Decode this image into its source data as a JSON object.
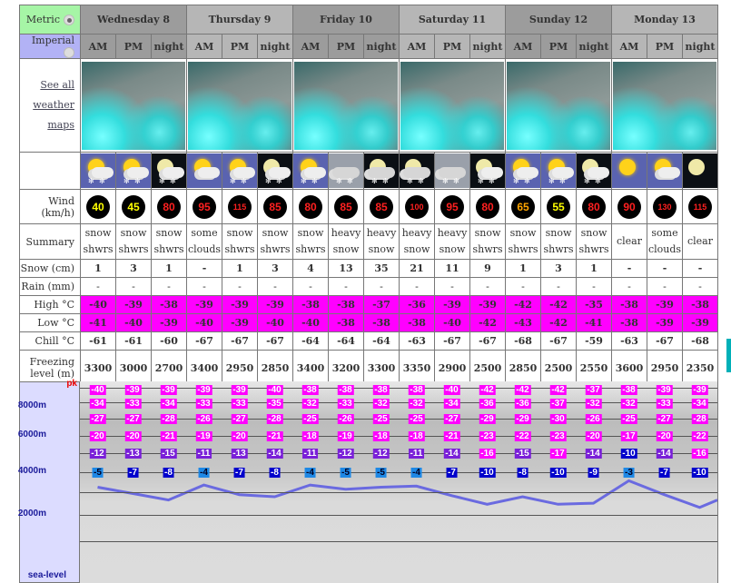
{
  "units": {
    "metric": "Metric",
    "imperial": "Imperial",
    "selected": "metric"
  },
  "days": [
    "Wednesday 8",
    "Thursday 9",
    "Friday 10",
    "Saturday 11",
    "Sunday 12",
    "Monday 13"
  ],
  "periods": [
    "AM",
    "PM",
    "night"
  ],
  "maps_link": [
    "See all",
    "weather",
    "maps"
  ],
  "labels": {
    "wind": [
      "Wind",
      "(km/h)"
    ],
    "summary": "Summary",
    "snow": "Snow (cm)",
    "rain": "Rain (mm)",
    "high": "High °C",
    "low": "Low °C",
    "chill": "Chill °C",
    "freezing": [
      "Freezing",
      "level (m)"
    ]
  },
  "icons": [
    "snow-showers-day",
    "snow-showers-day",
    "snow-showers-night",
    "some-clouds-day",
    "snow-showers-day",
    "snow-showers-night",
    "snow-showers-day",
    "heavy-snow",
    "heavy-snow-night",
    "heavy-snow-night",
    "heavy-snow",
    "snow-showers-night",
    "snow-showers-day",
    "snow-showers-day",
    "snow-showers-night",
    "clear-day",
    "some-clouds-day",
    "clear-night"
  ],
  "wind": [
    40,
    45,
    80,
    95,
    115,
    85,
    80,
    85,
    85,
    100,
    95,
    80,
    65,
    55,
    80,
    90,
    130,
    115
  ],
  "wind_colors": {
    "40": "#ffff00",
    "45": "#ffff00",
    "55": "#ffff00",
    "65": "#ffa500",
    "default": "#ff2020"
  },
  "summary": [
    [
      "snow",
      "shwrs"
    ],
    [
      "snow",
      "shwrs"
    ],
    [
      "snow",
      "shwrs"
    ],
    [
      "some",
      "clouds"
    ],
    [
      "snow",
      "shwrs"
    ],
    [
      "snow",
      "shwrs"
    ],
    [
      "snow",
      "shwrs"
    ],
    [
      "heavy",
      "snow"
    ],
    [
      "heavy",
      "snow"
    ],
    [
      "heavy",
      "snow"
    ],
    [
      "heavy",
      "snow"
    ],
    [
      "snow",
      "shwrs"
    ],
    [
      "snow",
      "shwrs"
    ],
    [
      "snow",
      "shwrs"
    ],
    [
      "snow",
      "shwrs"
    ],
    [
      "clear"
    ],
    [
      "some",
      "clouds"
    ],
    [
      "clear"
    ]
  ],
  "snow": [
    "1",
    "3",
    "1",
    "-",
    "1",
    "3",
    "4",
    "13",
    "35",
    "21",
    "11",
    "9",
    "1",
    "3",
    "1",
    "-",
    "-",
    "-"
  ],
  "rain": [
    "-",
    "-",
    "-",
    "-",
    "-",
    "-",
    "-",
    "-",
    "-",
    "-",
    "-",
    "-",
    "-",
    "-",
    "-",
    "-",
    "-",
    "-"
  ],
  "high": [
    "-40",
    "-39",
    "-38",
    "-39",
    "-39",
    "-39",
    "-38",
    "-38",
    "-37",
    "-36",
    "-39",
    "-39",
    "-42",
    "-42",
    "-35",
    "-38",
    "-39",
    "-38"
  ],
  "low": [
    "-41",
    "-40",
    "-39",
    "-40",
    "-39",
    "-40",
    "-40",
    "-38",
    "-38",
    "-38",
    "-40",
    "-42",
    "-43",
    "-42",
    "-41",
    "-38",
    "-39",
    "-39"
  ],
  "chill": [
    "-61",
    "-61",
    "-60",
    "-67",
    "-67",
    "-67",
    "-64",
    "-64",
    "-64",
    "-63",
    "-67",
    "-67",
    "-68",
    "-67",
    "-59",
    "-63",
    "-67",
    "-68"
  ],
  "freezing": [
    3300,
    3000,
    2700,
    3400,
    2950,
    2850,
    3400,
    3200,
    3300,
    3350,
    2900,
    2500,
    2850,
    2500,
    2550,
    3600,
    2950,
    2350
  ],
  "chart_data": {
    "type": "line",
    "y_labels": [
      "pk",
      "8000m",
      "6000m",
      "4000m",
      "2000m",
      "sea-level"
    ],
    "freezing_level_m": [
      3300,
      3000,
      2700,
      3400,
      2950,
      2850,
      3400,
      3200,
      3300,
      3350,
      2900,
      2500,
      2850,
      2500,
      2550,
      3600,
      2950,
      2350
    ],
    "altitude_temps": [
      [
        "-40",
        "-39",
        "-39",
        "-39",
        "-39",
        "-40",
        "-38",
        "-38",
        "-38",
        "-38",
        "-40",
        "-42",
        "-42",
        "-42",
        "-37",
        "-38",
        "-39",
        "-39"
      ],
      [
        "-34",
        "-33",
        "-34",
        "-33",
        "-33",
        "-35",
        "-32",
        "-33",
        "-32",
        "-32",
        "-34",
        "-36",
        "-36",
        "-37",
        "-32",
        "-32",
        "-33",
        "-34"
      ],
      [
        "-27",
        "-27",
        "-28",
        "-26",
        "-27",
        "-28",
        "-25",
        "-26",
        "-25",
        "-25",
        "-27",
        "-29",
        "-29",
        "-30",
        "-26",
        "-25",
        "-27",
        "-28"
      ],
      [
        "-20",
        "-20",
        "-21",
        "-19",
        "-20",
        "-21",
        "-18",
        "-19",
        "-18",
        "-18",
        "-21",
        "-23",
        "-22",
        "-23",
        "-20",
        "-17",
        "-20",
        "-22"
      ],
      [
        "-12",
        "-13",
        "-15",
        "-11",
        "-13",
        "-14",
        "-11",
        "-12",
        "-12",
        "-11",
        "-14",
        "-16",
        "-15",
        "-17",
        "-14",
        "-10",
        "-14",
        "-16"
      ],
      [
        "-5",
        "-7",
        "-8",
        "-4",
        "-7",
        "-8",
        "-4",
        "-5",
        "-5",
        "-4",
        "-7",
        "-10",
        "-8",
        "-10",
        "-9",
        "-3",
        "-7",
        "-10"
      ]
    ],
    "temp_colors": {
      "cold": "#ff00ff",
      "cool": "#7a1fd8",
      "mild": "#0000cc",
      "warm": "#1e88e5"
    },
    "line_color": "#6a6ae0"
  }
}
